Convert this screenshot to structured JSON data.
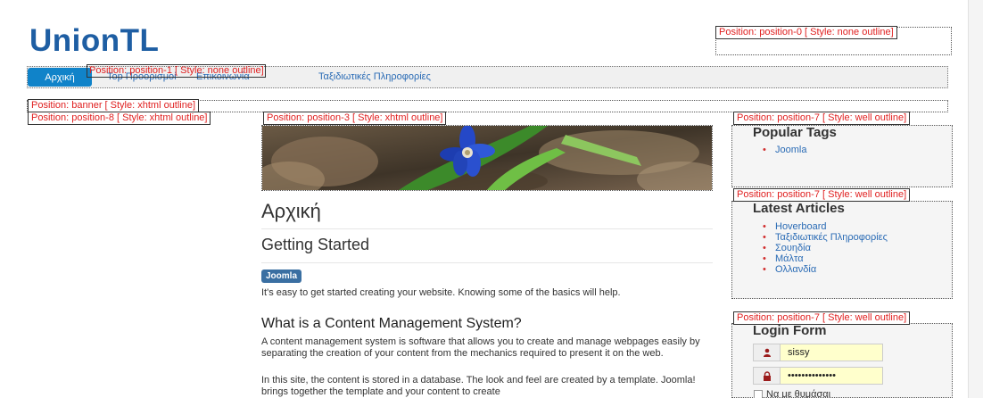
{
  "site": {
    "title": "UnionTL"
  },
  "nav": {
    "items": [
      "Αρχική",
      "Top Προορισμοί",
      "Επικοινωνία",
      "Ταξιδιωτικές Πληροφορίες"
    ],
    "active_index": 0
  },
  "positions": {
    "p0": "Position: position-0 [ Style: none outline]",
    "p1": "Position: position-1 [ Style: none outline]",
    "banner": "Position: banner [ Style: xhtml outline]",
    "p8": "Position: position-8 [ Style: xhtml outline]",
    "p3": "Position: position-3 [ Style: xhtml outline]",
    "p7a": "Position: position-7 [ Style: well outline]",
    "p7b": "Position: position-7 [ Style: well outline]",
    "p7c": "Position: position-7 [ Style: well outline]"
  },
  "article": {
    "page_title": "Αρχική",
    "heading": "Getting Started",
    "tag": "Joomla",
    "intro": "It's easy to get started creating your website. Knowing some of the basics will help.",
    "cms_heading": "What is a Content Management System?",
    "cms_para": "A content management system is software that allows you to create and manage webpages easily by separating the creation of your content from the mechanics required to present it on the web.",
    "cms_para2": "In this site, the content is stored in a database. The look and feel are created by a template. Joomla! brings together the template and your content to create"
  },
  "popular_tags": {
    "title": "Popular Tags",
    "items": [
      "Joomla"
    ]
  },
  "latest_articles": {
    "title": "Latest Articles",
    "items": [
      "Hoverboard",
      "Ταξιδιωτικές Πληροφορίες",
      "Σουηδία",
      "Μάλτα",
      "Ολλανδία"
    ]
  },
  "login": {
    "title": "Login Form",
    "username": "sissy",
    "password": "••••••••••••••",
    "remember_label": "Να με θυμάσαι",
    "user_icon": "user-icon",
    "lock_icon": "lock-icon"
  },
  "colors": {
    "brand": "#1e5ea3",
    "nav_active": "#1083c9",
    "label_red": "#e02020",
    "link": "#2a6bb5",
    "autofill": "#ffffcc"
  }
}
